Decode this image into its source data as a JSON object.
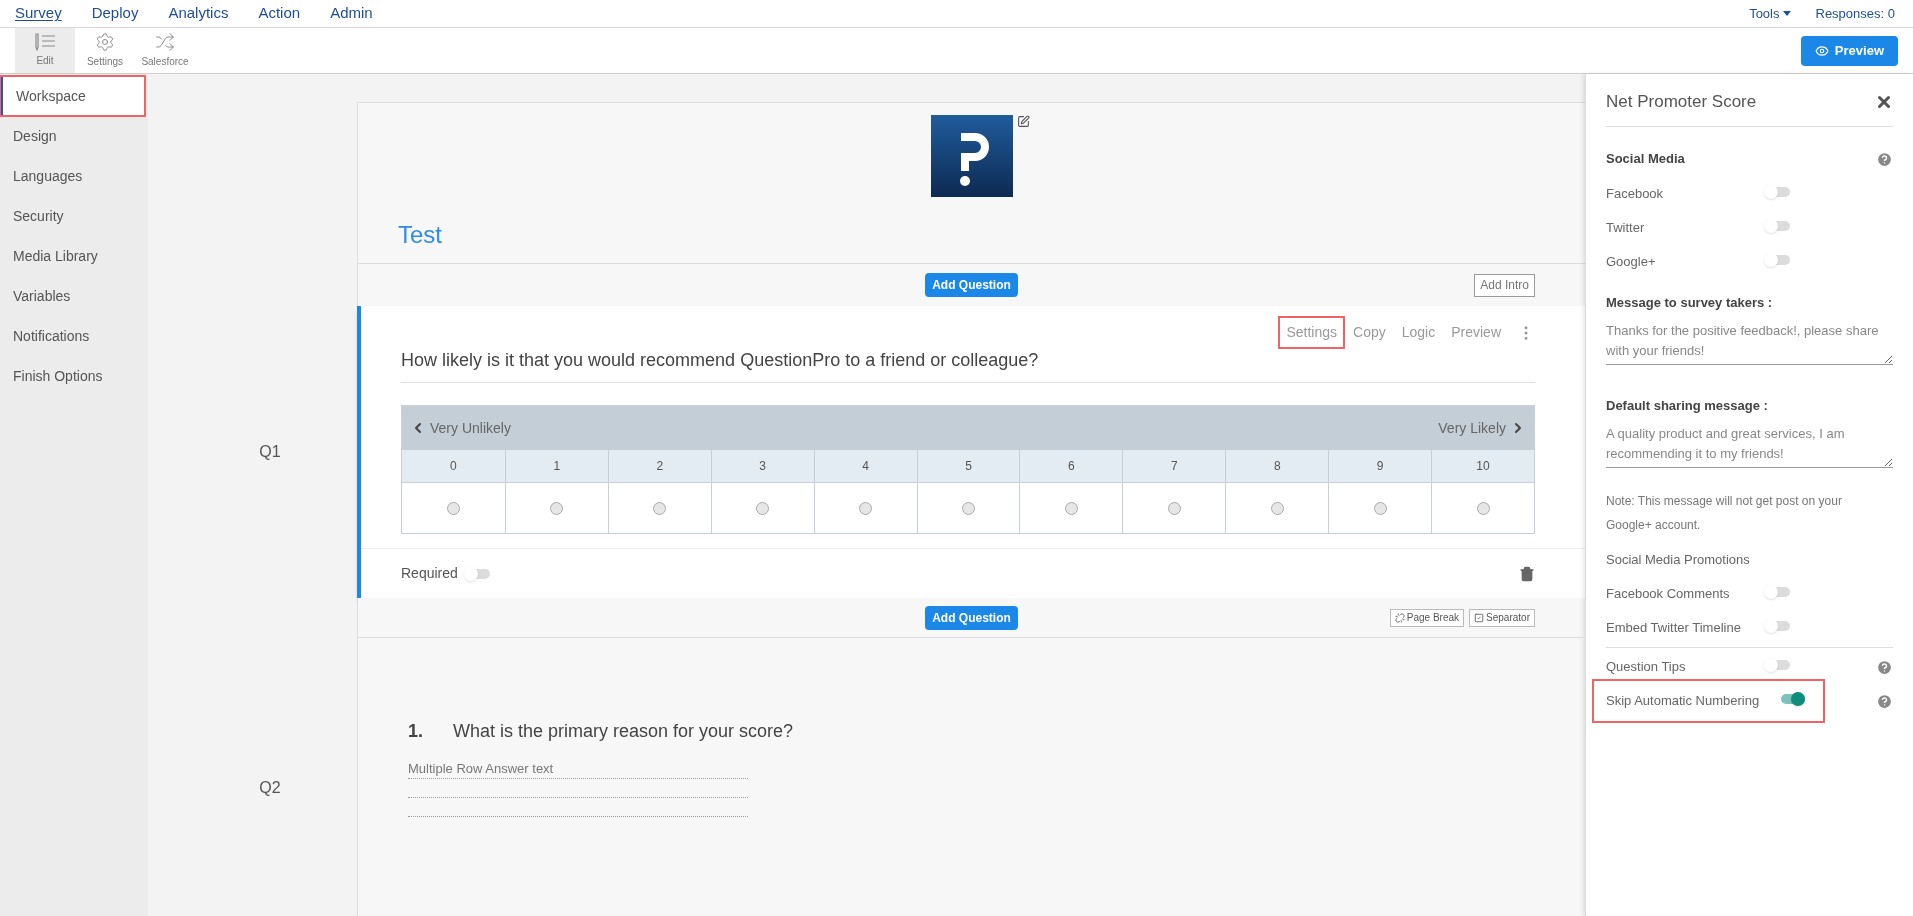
{
  "nav": {
    "tabs": [
      {
        "label": "Survey",
        "selected": true
      },
      {
        "label": "Deploy",
        "selected": false
      },
      {
        "label": "Analytics",
        "selected": false
      },
      {
        "label": "Action",
        "selected": false
      },
      {
        "label": "Admin",
        "selected": false
      }
    ],
    "tools": "Tools",
    "responses": "Responses: 0"
  },
  "toolbar": {
    "items": [
      {
        "label": "Edit",
        "kind": "edit",
        "selected": true
      },
      {
        "label": "Settings",
        "kind": "settings",
        "selected": false
      },
      {
        "label": "Salesforce",
        "kind": "salesforce",
        "selected": false
      }
    ],
    "preview": "Preview"
  },
  "sidebar": {
    "items": [
      {
        "label": "Workspace",
        "selected": true,
        "highlighted": true
      },
      {
        "label": "Design",
        "selected": false,
        "highlighted": false
      },
      {
        "label": "Languages",
        "selected": false,
        "highlighted": false
      },
      {
        "label": "Security",
        "selected": false,
        "highlighted": false
      },
      {
        "label": "Media Library",
        "selected": false,
        "highlighted": false
      },
      {
        "label": "Variables",
        "selected": false,
        "highlighted": false
      },
      {
        "label": "Notifications",
        "selected": false,
        "highlighted": false
      },
      {
        "label": "Finish Options",
        "selected": false,
        "highlighted": false
      }
    ]
  },
  "survey": {
    "title": "Test",
    "add_question": "Add Question",
    "add_intro": "Add Intro",
    "q1": {
      "label": "Q1",
      "actions": [
        {
          "label": "Settings",
          "highlighted": true
        },
        {
          "label": "Copy",
          "highlighted": false
        },
        {
          "label": "Logic",
          "highlighted": false
        },
        {
          "label": "Preview",
          "highlighted": false
        }
      ],
      "text": "How likely is it that you would recommend QuestionPro to a friend or colleague?",
      "scale_left": "Very Unlikely",
      "scale_right": "Very Likely",
      "points": [
        {
          "label": "0",
          "selected": false
        },
        {
          "label": "1",
          "selected": false
        },
        {
          "label": "2",
          "selected": false
        },
        {
          "label": "3",
          "selected": false
        },
        {
          "label": "4",
          "selected": false
        },
        {
          "label": "5",
          "selected": false
        },
        {
          "label": "6",
          "selected": false
        },
        {
          "label": "7",
          "selected": false
        },
        {
          "label": "8",
          "selected": false
        },
        {
          "label": "9",
          "selected": false
        },
        {
          "label": "10",
          "selected": false
        }
      ],
      "required": {
        "label": "Required",
        "on": false
      }
    },
    "between": {
      "add_question": "Add Question",
      "page_break": "Page Break",
      "separator": "Separator"
    },
    "q2": {
      "label": "Q2",
      "index": "1.",
      "text": "What is the primary reason for your score?",
      "placeholder": "Multiple Row Answer text"
    }
  },
  "panel": {
    "title": "Net Promoter Score",
    "rows": [
      {
        "kind": "heading",
        "label": "Social Media",
        "help": true
      },
      {
        "kind": "toggle",
        "label": "Facebook",
        "on": false,
        "help": false,
        "highlighted": false
      },
      {
        "kind": "toggle",
        "label": "Twitter",
        "on": false,
        "help": false,
        "highlighted": false
      },
      {
        "kind": "toggle",
        "label": "Google+",
        "on": false,
        "help": false,
        "highlighted": false
      },
      {
        "kind": "heading",
        "label": "Message to survey takers :",
        "help": false
      },
      {
        "kind": "textarea",
        "value": "Thanks for the positive feedback!, please share with your friends!"
      },
      {
        "kind": "heading",
        "label": "Default sharing message :",
        "help": false
      },
      {
        "kind": "textarea",
        "value": "A quality product and great services, I am recommending it to my friends!"
      },
      {
        "kind": "note",
        "label": "Note: This message will not get post on your Google+ account."
      },
      {
        "kind": "label",
        "label": "Social Media Promotions"
      },
      {
        "kind": "toggle",
        "label": "Facebook Comments",
        "on": false,
        "help": false,
        "highlighted": false
      },
      {
        "kind": "toggle",
        "label": "Embed Twitter Timeline",
        "on": false,
        "help": false,
        "highlighted": false
      },
      {
        "kind": "divider"
      },
      {
        "kind": "toggle",
        "label": "Question Tips",
        "on": false,
        "help": true,
        "highlighted": false
      },
      {
        "kind": "toggle",
        "label": "Skip Automatic Numbering",
        "on": true,
        "help": true,
        "highlighted": true
      }
    ]
  }
}
